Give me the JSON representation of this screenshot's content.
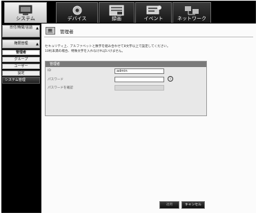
{
  "tabs": [
    {
      "label": "システム",
      "icon": "system-monitor-icon",
      "active": true
    },
    {
      "label": "デバイス",
      "icon": "camera-icon",
      "active": false
    },
    {
      "label": "録画",
      "icon": "recording-icon",
      "active": false
    },
    {
      "label": "イベント",
      "icon": "event-icon",
      "active": false
    },
    {
      "label": "ネットワーク",
      "icon": "network-icon",
      "active": false
    }
  ],
  "sidebar": {
    "date_time": "日付/時間/言語",
    "rights": "権限管理",
    "sub_items": [
      "管理者",
      "グループ",
      "ユーザー",
      "設定"
    ],
    "system_mgmt": "システム管理"
  },
  "page": {
    "title": "管理者",
    "note_line1": "セキュリティ上、アルファベットと数字を組み合わせて8文字以上で設定してください。",
    "note_line2": "10桁未満の場合、特殊文字を入れなければいけません。"
  },
  "form": {
    "header": "管理者",
    "id_label": "ID",
    "id_value": "admin",
    "password_label": "パスワード",
    "password_value": "",
    "confirm_label": "パスワードを確認",
    "confirm_value": ""
  },
  "buttons": {
    "apply": "適用",
    "cancel": "キャンセル"
  },
  "colors": {
    "active_tab": "#e4e4e4",
    "inactive_tab": "#2a2a2a",
    "form_header": "#7a7a7a",
    "background": "#000000"
  }
}
